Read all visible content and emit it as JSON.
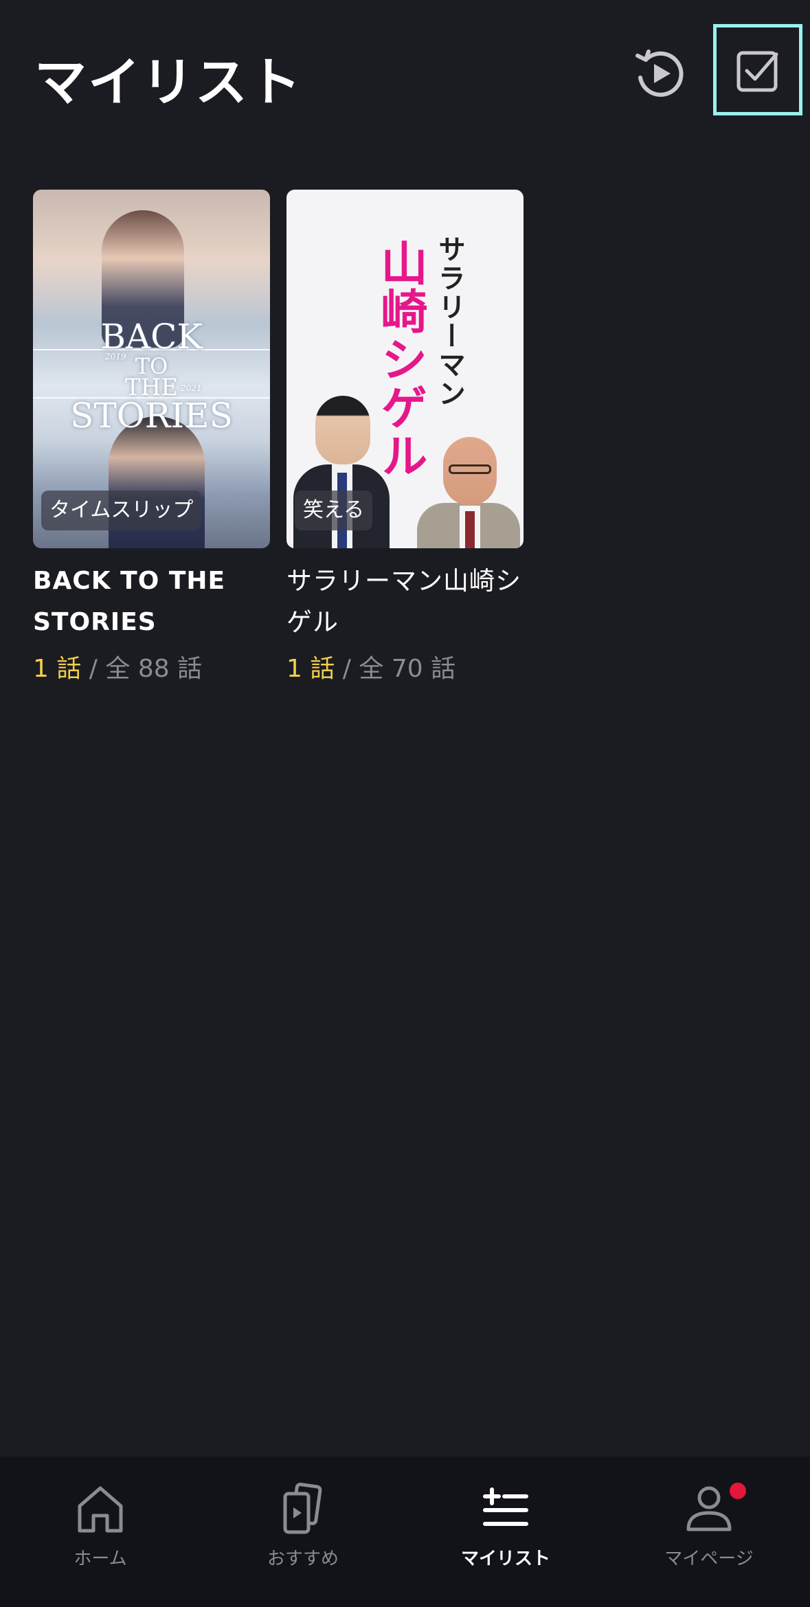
{
  "header": {
    "title": "マイリスト",
    "history_icon": "history-play-icon",
    "select_icon": "checkbox-select-icon"
  },
  "items": [
    {
      "title": "BACK TO THE STORIES",
      "title_lines": [
        "BACK TO THE",
        "STORIES"
      ],
      "tag": "タイムスリップ",
      "watched": "1 話",
      "total": " / 全 88 話",
      "poster_text": {
        "line1": "BACK",
        "line2": "TO",
        "line3": "THE",
        "line4": "STORIES",
        "year_left": "2019",
        "year_right": "2021"
      }
    },
    {
      "title": "サラリーマン山崎シゲル",
      "title_lines": [
        "サラリーマン山崎シ",
        "ゲル"
      ],
      "tag": "笑える",
      "watched": "1 話",
      "total": " / 全 70 話",
      "poster_text": {
        "sub": "サラリーマン",
        "main": "山崎シゲル"
      }
    }
  ],
  "tabbar": {
    "tabs": [
      {
        "label": "ホーム",
        "icon": "home-icon"
      },
      {
        "label": "おすすめ",
        "icon": "recommend-cards-icon"
      },
      {
        "label": "マイリスト",
        "icon": "mylist-add-icon",
        "active": true
      },
      {
        "label": "マイページ",
        "icon": "user-icon",
        "badge": true
      }
    ]
  },
  "colors": {
    "background": "#1b1c22",
    "tabbar": "#121319",
    "accent_yellow": "#f4cf4a",
    "highlight_border": "#9af2ee",
    "badge_red": "#e3173b",
    "muted_text": "#8b8c92"
  }
}
